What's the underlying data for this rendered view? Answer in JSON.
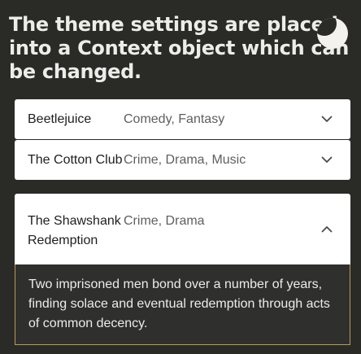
{
  "headline": "The theme settings are placed into a Context object which can be changed.",
  "theme_toggle": {
    "icon": "moon-icon"
  },
  "accordion": {
    "items": [
      {
        "title": "Beetlejuice",
        "genre": "Comedy, Fantasy",
        "expanded": false
      },
      {
        "title": "The Cotton Club",
        "genre": "Crime, Drama, Music",
        "expanded": false
      },
      {
        "title": "The Shawshank Redemption",
        "genre": "Crime, Drama",
        "expanded": true,
        "description": "Two imprisoned men bond over a number of years, finding solace and eventual redemption through acts of common decency."
      }
    ]
  },
  "colors": {
    "background": "#2a2a27",
    "panel": "#ffffff",
    "expanded_body": "#2f302d",
    "expanded_border": "#b59a54"
  }
}
